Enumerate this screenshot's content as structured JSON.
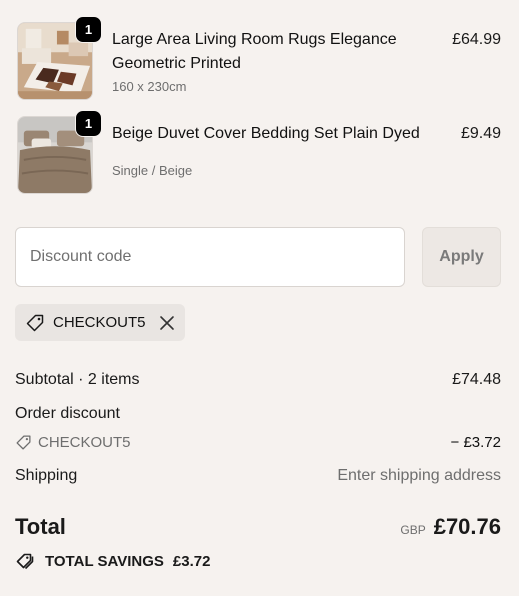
{
  "colors": {
    "page_background": "#f6f2ef",
    "badge": "#000000",
    "muted_text": "#6e6e6e"
  },
  "line_items": [
    {
      "quantity": "1",
      "title": "Large Area Living Room Rugs Elegance Geometric Printed",
      "variant": "160 x 230cm",
      "price": "£64.99",
      "thumbnail": "rug-photo"
    },
    {
      "quantity": "1",
      "title": "Beige Duvet Cover Bedding Set Plain Dyed",
      "variant": "Single / Beige",
      "price": "£9.49",
      "thumbnail": "bedding-photo"
    }
  ],
  "discount": {
    "input_value": "",
    "placeholder": "Discount code",
    "apply_label": "Apply",
    "applied_code": "CHECKOUT5"
  },
  "summary": {
    "subtotal_label": "Subtotal · 2 items",
    "subtotal_value": "£74.48",
    "order_discount_label": "Order discount",
    "discount_code": "CHECKOUT5",
    "discount_value": "− £3.72",
    "shipping_label": "Shipping",
    "shipping_value": "Enter shipping address",
    "total_label": "Total",
    "currency": "GBP",
    "total_value": "£70.76",
    "savings_label": "TOTAL SAVINGS",
    "savings_value": "£3.72"
  },
  "icons": {
    "tag": "tag-icon",
    "remove": "close-icon",
    "savings": "double-tag-icon"
  }
}
